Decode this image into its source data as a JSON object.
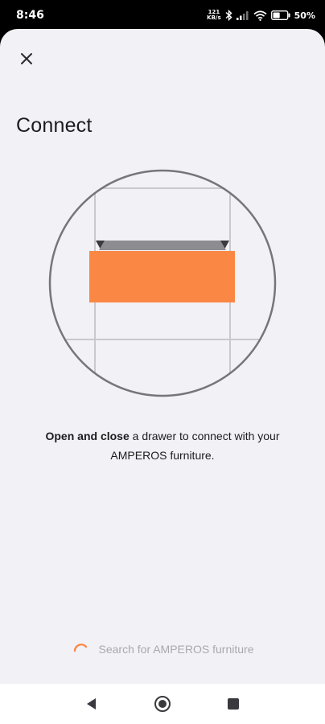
{
  "status_bar": {
    "time": "8:46",
    "speed_value": "121",
    "speed_unit": "KB/s",
    "battery_percent": "50"
  },
  "screen": {
    "title": "Connect",
    "instruction_bold_1": "Open",
    "instruction_and": " and ",
    "instruction_bold_2": "close",
    "instruction_rest": " a drawer to connect with your AMPEROS furniture.",
    "search_status": "Search for AMPEROS furniture"
  },
  "colors": {
    "accent": "#fb8745",
    "background": "#f2f1f6"
  },
  "icons": {
    "close": "close-icon",
    "back": "back-triangle-icon",
    "home": "home-circle-icon",
    "recents": "recents-square-icon"
  }
}
